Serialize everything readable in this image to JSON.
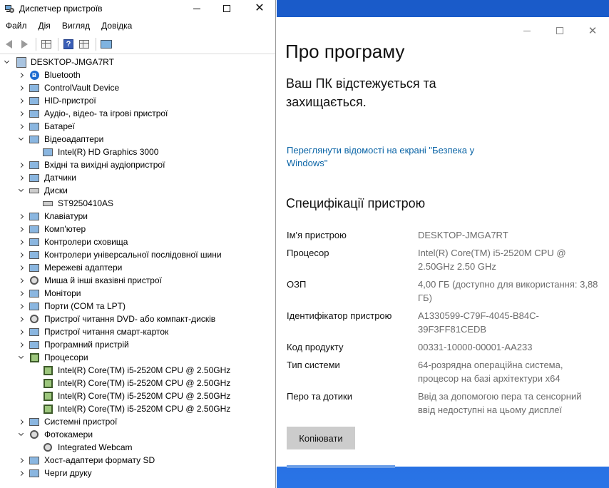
{
  "device_manager": {
    "title": "Диспетчер пристроїв",
    "menu": [
      "Файл",
      "Дія",
      "Вигляд",
      "Довідка"
    ],
    "root": "DESKTOP-JMGA7RT",
    "tree": [
      {
        "label": "Bluetooth",
        "level": 1,
        "state": "collapsed",
        "icon": "bluetooth-icon"
      },
      {
        "label": "ControlVault Device",
        "level": 1,
        "state": "collapsed",
        "icon": "device-icon"
      },
      {
        "label": "HID-пристрої",
        "level": 1,
        "state": "collapsed",
        "icon": "hid-icon"
      },
      {
        "label": "Аудіо-, відео- та ігрові пристрої",
        "level": 1,
        "state": "collapsed",
        "icon": "speaker-icon"
      },
      {
        "label": "Батареї",
        "level": 1,
        "state": "collapsed",
        "icon": "battery-icon"
      },
      {
        "label": "Відеоадаптери",
        "level": 1,
        "state": "expanded",
        "icon": "display-adapter-icon"
      },
      {
        "label": "Intel(R) HD Graphics 3000",
        "level": 2,
        "state": "leaf",
        "icon": "display-adapter-icon"
      },
      {
        "label": "Вхідні та вихідні аудіопристрої",
        "level": 1,
        "state": "collapsed",
        "icon": "speaker-icon"
      },
      {
        "label": "Датчики",
        "level": 1,
        "state": "collapsed",
        "icon": "sensor-icon"
      },
      {
        "label": "Диски",
        "level": 1,
        "state": "expanded",
        "icon": "disk-icon"
      },
      {
        "label": "ST9250410AS",
        "level": 2,
        "state": "leaf",
        "icon": "disk-icon"
      },
      {
        "label": "Клавіатури",
        "level": 1,
        "state": "collapsed",
        "icon": "keyboard-icon"
      },
      {
        "label": "Комп'ютер",
        "level": 1,
        "state": "collapsed",
        "icon": "computer-icon"
      },
      {
        "label": "Контролери сховища",
        "level": 1,
        "state": "collapsed",
        "icon": "storage-controller-icon"
      },
      {
        "label": "Контролери універсальної послідовної шини",
        "level": 1,
        "state": "collapsed",
        "icon": "usb-icon"
      },
      {
        "label": "Мережеві адаптери",
        "level": 1,
        "state": "collapsed",
        "icon": "network-icon"
      },
      {
        "label": "Миша й інші вказівні пристрої",
        "level": 1,
        "state": "collapsed",
        "icon": "mouse-icon"
      },
      {
        "label": "Монітори",
        "level": 1,
        "state": "collapsed",
        "icon": "monitor-icon"
      },
      {
        "label": "Порти (COM та LPT)",
        "level": 1,
        "state": "collapsed",
        "icon": "port-icon"
      },
      {
        "label": "Пристрої читання DVD- або компакт-дисків",
        "level": 1,
        "state": "collapsed",
        "icon": "dvd-icon"
      },
      {
        "label": "Пристрої читання смарт-карток",
        "level": 1,
        "state": "collapsed",
        "icon": "smartcard-icon"
      },
      {
        "label": "Програмний пристрій",
        "level": 1,
        "state": "collapsed",
        "icon": "software-device-icon"
      },
      {
        "label": "Процесори",
        "level": 1,
        "state": "expanded",
        "icon": "cpu-icon"
      },
      {
        "label": "Intel(R) Core(TM) i5-2520M CPU @ 2.50GHz",
        "level": 2,
        "state": "leaf",
        "icon": "cpu-icon"
      },
      {
        "label": "Intel(R) Core(TM) i5-2520M CPU @ 2.50GHz",
        "level": 2,
        "state": "leaf",
        "icon": "cpu-icon"
      },
      {
        "label": "Intel(R) Core(TM) i5-2520M CPU @ 2.50GHz",
        "level": 2,
        "state": "leaf",
        "icon": "cpu-icon"
      },
      {
        "label": "Intel(R) Core(TM) i5-2520M CPU @ 2.50GHz",
        "level": 2,
        "state": "leaf",
        "icon": "cpu-icon"
      },
      {
        "label": "Системні пристрої",
        "level": 1,
        "state": "collapsed",
        "icon": "system-device-icon"
      },
      {
        "label": "Фотокамери",
        "level": 1,
        "state": "expanded",
        "icon": "camera-icon"
      },
      {
        "label": "Integrated Webcam",
        "level": 2,
        "state": "leaf",
        "icon": "camera-icon"
      },
      {
        "label": "Хост-адаптери формату SD",
        "level": 1,
        "state": "collapsed",
        "icon": "sd-host-icon"
      },
      {
        "label": "Черги друку",
        "level": 1,
        "state": "collapsed",
        "icon": "printer-icon"
      }
    ]
  },
  "settings": {
    "page_title": "Про програму",
    "protection_text": "Ваш ПК відстежується та захищається.",
    "security_link": "Переглянути відомості на екрані \"Безпека у Windows\"",
    "specs_title": "Специфікації пристрою",
    "specs": [
      {
        "key": "Ім'я пристрою",
        "value": "DESKTOP-JMGA7RT"
      },
      {
        "key": "Процесор",
        "value": "Intel(R) Core(TM) i5-2520M CPU @ 2.50GHz   2.50 GHz"
      },
      {
        "key": "ОЗП",
        "value": "4,00 ГБ (доступно для використання: 3,88 ГБ)"
      },
      {
        "key": "Ідентифікатор пристрою",
        "value": "A1330599-C79F-4045-B84C-39F3FF81CEDB"
      },
      {
        "key": "Код продукту",
        "value": "00331-10000-00001-AA233"
      },
      {
        "key": "Тип системи",
        "value": "64-розрядна операційна система, процесор на базі архітектури x64"
      },
      {
        "key": "Перо та дотики",
        "value": "Ввід за допомогою пера та сенсорний ввід недоступні на цьому дисплеї"
      }
    ],
    "copy_button": "Копіювати"
  }
}
